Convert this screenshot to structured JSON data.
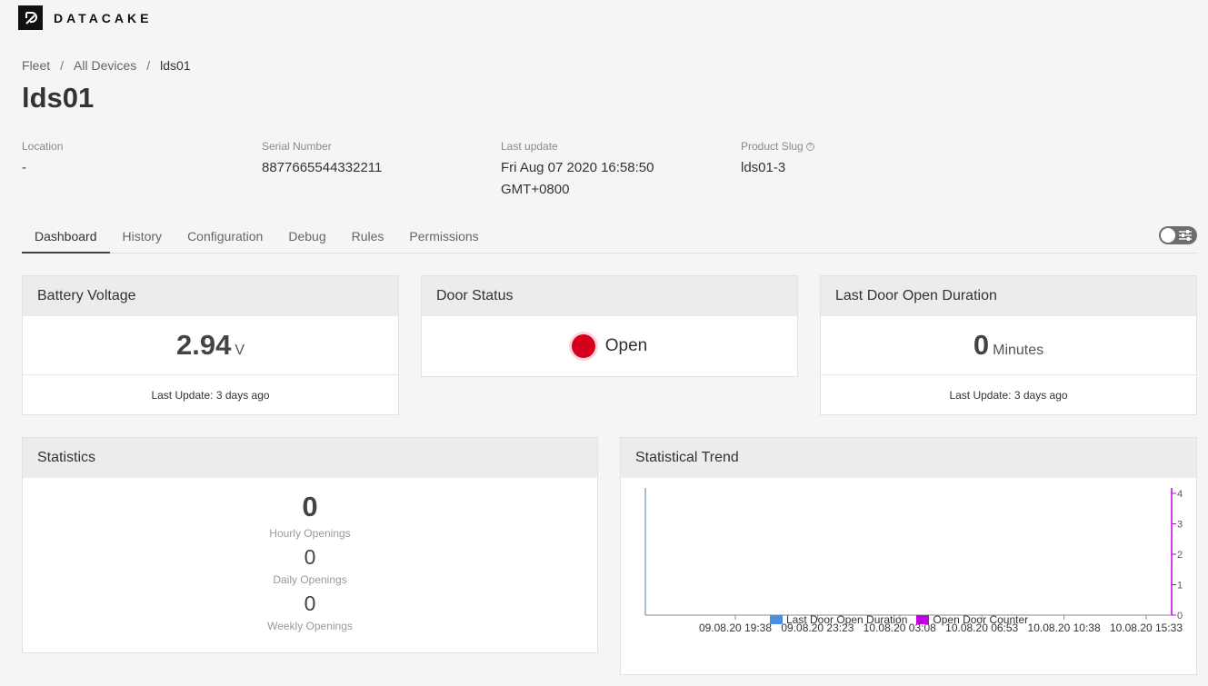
{
  "app": {
    "logo_text": "DATACAKE"
  },
  "breadcrumb": [
    "Fleet",
    "All Devices",
    "lds01"
  ],
  "page": {
    "title": "lds01"
  },
  "meta": {
    "location": {
      "label": "Location",
      "value": "-"
    },
    "serial": {
      "label": "Serial Number",
      "value": "8877665544332211"
    },
    "last_update": {
      "label": "Last update",
      "value_line1": "Fri Aug 07 2020 16:58:50",
      "value_line2": "GMT+0800"
    },
    "product_slug": {
      "label": "Product Slug",
      "value": "lds01-3"
    }
  },
  "tabs": [
    {
      "label": "Dashboard",
      "active": true
    },
    {
      "label": "History"
    },
    {
      "label": "Configuration"
    },
    {
      "label": "Debug"
    },
    {
      "label": "Rules"
    },
    {
      "label": "Permissions"
    }
  ],
  "widgets": {
    "battery": {
      "title": "Battery Voltage",
      "value": "2.94",
      "unit": "V",
      "footer": "Last Update: 3 days ago"
    },
    "door": {
      "title": "Door Status",
      "value": "Open",
      "color": "#d6001c"
    },
    "duration": {
      "title": "Last Door Open Duration",
      "value": "0",
      "unit": "Minutes",
      "footer": "Last Update: 3 days ago"
    },
    "statistics": {
      "title": "Statistics",
      "hourly": {
        "value": "0",
        "label": "Hourly Openings"
      },
      "daily": {
        "value": "0",
        "label": "Daily Openings"
      },
      "weekly": {
        "value": "0",
        "label": "Weekly Openings"
      }
    },
    "trend": {
      "title": "Statistical Trend"
    }
  },
  "chart_data": {
    "type": "line",
    "x_ticks": [
      "09.08.20 19:38",
      "09.08.20 23:23",
      "10.08.20 03:08",
      "10.08.20 06:53",
      "10.08.20 10:38",
      "10.08.20 15:33"
    ],
    "y2_ticks": [
      "0",
      "1",
      "2",
      "3",
      "4"
    ],
    "y2lim": [
      0,
      4
    ],
    "series": [
      {
        "name": "Last Door Open Duration",
        "color": "#4a90e2"
      },
      {
        "name": "Open Door Counter",
        "color": "#c000e0"
      }
    ],
    "legend": "bottom"
  }
}
